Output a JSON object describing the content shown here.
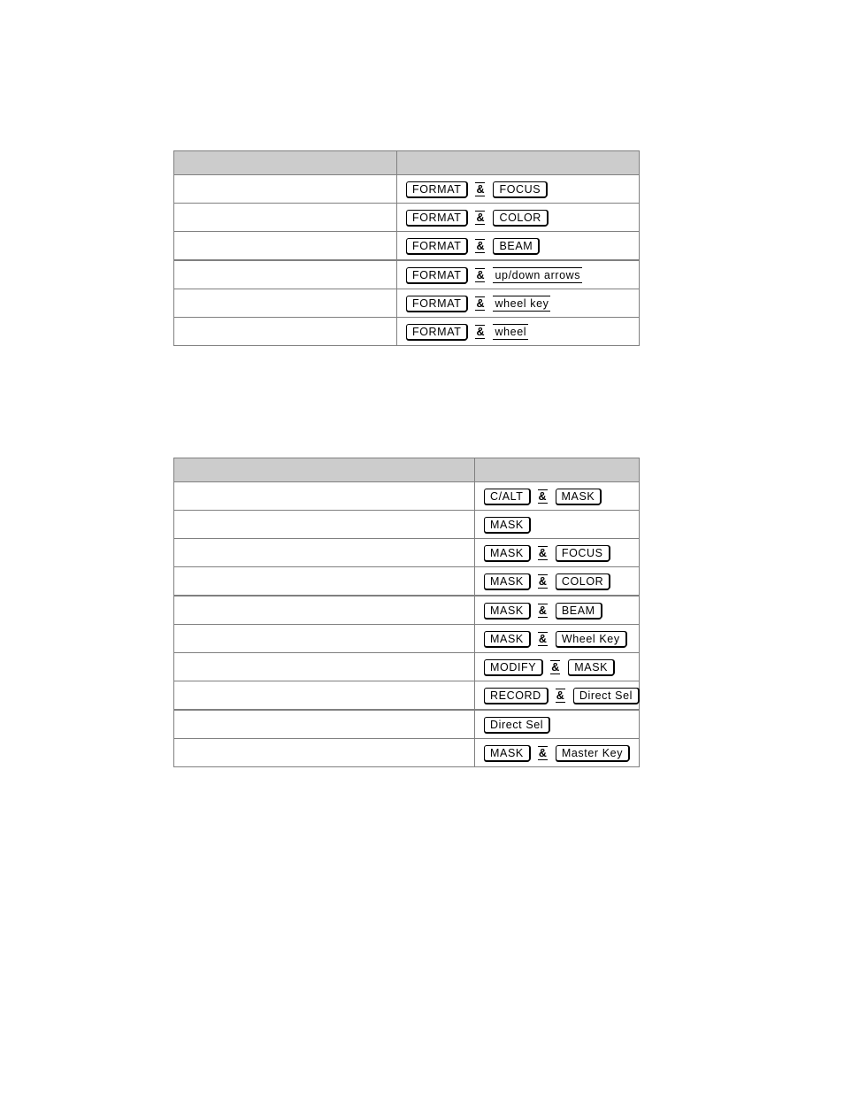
{
  "page": {
    "background_color": "#ffffff",
    "header_fill_color": "#cccccc",
    "border_color": "#808080",
    "key_border_color": "#000000"
  },
  "tables": [
    {
      "name": "format-key-combinations-table",
      "header": {
        "col1": "",
        "col2": ""
      },
      "rows": [
        {
          "desc": "",
          "combo": [
            {
              "type": "keycap",
              "label": "FORMAT"
            },
            {
              "type": "amp",
              "label": "&"
            },
            {
              "type": "keycap",
              "label": "FOCUS"
            }
          ]
        },
        {
          "desc": "",
          "combo": [
            {
              "type": "keycap",
              "label": "FORMAT"
            },
            {
              "type": "amp",
              "label": "&"
            },
            {
              "type": "keycap",
              "label": "COLOR"
            }
          ]
        },
        {
          "desc": "",
          "combo": [
            {
              "type": "keycap",
              "label": "FORMAT"
            },
            {
              "type": "amp",
              "label": "&"
            },
            {
              "type": "keycap",
              "label": "BEAM"
            }
          ],
          "thick_bottom": true
        },
        {
          "desc": "",
          "combo": [
            {
              "type": "keycap",
              "label": "FORMAT"
            },
            {
              "type": "amp",
              "label": "&"
            },
            {
              "type": "keytext",
              "label": "up/down arrows"
            }
          ]
        },
        {
          "desc": "",
          "combo": [
            {
              "type": "keycap",
              "label": "FORMAT"
            },
            {
              "type": "amp",
              "label": "&"
            },
            {
              "type": "keytext",
              "label": "wheel key"
            }
          ]
        },
        {
          "desc": "",
          "combo": [
            {
              "type": "keycap",
              "label": "FORMAT"
            },
            {
              "type": "amp",
              "label": "&"
            },
            {
              "type": "keytext",
              "label": "wheel"
            }
          ]
        }
      ]
    },
    {
      "name": "mask-key-combinations-table",
      "header": {
        "col1": "",
        "col2": ""
      },
      "rows": [
        {
          "desc": "",
          "combo": [
            {
              "type": "keycap",
              "label": "C/ALT"
            },
            {
              "type": "amp",
              "label": "&"
            },
            {
              "type": "keycap",
              "label": "MASK"
            }
          ]
        },
        {
          "desc": "",
          "combo": [
            {
              "type": "keycap",
              "label": "MASK"
            }
          ]
        },
        {
          "desc": "",
          "combo": [
            {
              "type": "keycap",
              "label": "MASK"
            },
            {
              "type": "amp",
              "label": "&"
            },
            {
              "type": "keycap",
              "label": "FOCUS"
            }
          ]
        },
        {
          "desc": "",
          "combo": [
            {
              "type": "keycap",
              "label": "MASK"
            },
            {
              "type": "amp",
              "label": "&"
            },
            {
              "type": "keycap",
              "label": "COLOR"
            }
          ],
          "thick_bottom": true
        },
        {
          "desc": "",
          "combo": [
            {
              "type": "keycap",
              "label": "MASK"
            },
            {
              "type": "amp",
              "label": "&"
            },
            {
              "type": "keycap",
              "label": "BEAM"
            }
          ]
        },
        {
          "desc": "",
          "combo": [
            {
              "type": "keycap",
              "label": "MASK"
            },
            {
              "type": "amp",
              "label": "&"
            },
            {
              "type": "keycap",
              "label": "Wheel Key"
            }
          ]
        },
        {
          "desc": "",
          "combo": [
            {
              "type": "keycap",
              "label": "MODIFY"
            },
            {
              "type": "amp",
              "label": "&"
            },
            {
              "type": "keycap",
              "label": "MASK"
            }
          ]
        },
        {
          "desc": "",
          "combo": [
            {
              "type": "keycap",
              "label": "RECORD"
            },
            {
              "type": "amp",
              "label": "&"
            },
            {
              "type": "keycap",
              "label": "Direct Sel"
            }
          ],
          "thick_bottom": true
        },
        {
          "desc": "",
          "combo": [
            {
              "type": "keycap",
              "label": "Direct Sel"
            }
          ]
        },
        {
          "desc": "",
          "combo": [
            {
              "type": "keycap",
              "label": "MASK"
            },
            {
              "type": "amp",
              "label": "&"
            },
            {
              "type": "keycap",
              "label": "Master Key"
            }
          ]
        }
      ]
    }
  ]
}
